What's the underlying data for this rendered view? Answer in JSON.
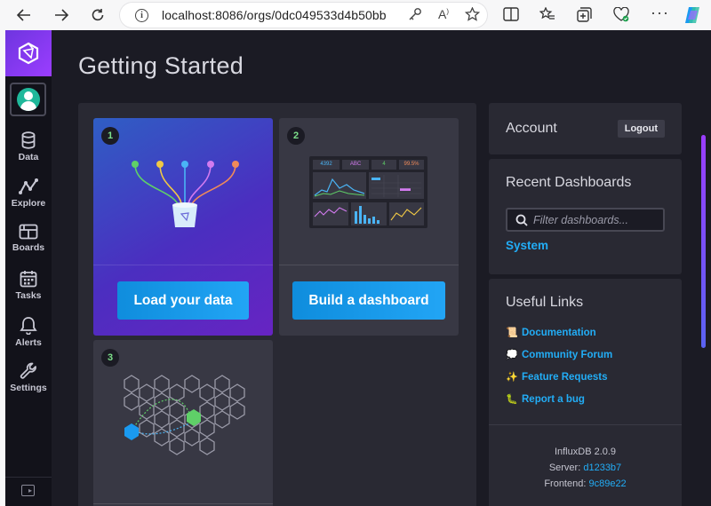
{
  "browser": {
    "url": "localhost:8086/orgs/0dc049533d4b50bb"
  },
  "sidebar": {
    "items": [
      {
        "label": "Data",
        "icon": "database-icon"
      },
      {
        "label": "Explore",
        "icon": "graph-icon"
      },
      {
        "label": "Boards",
        "icon": "dashboards-icon"
      },
      {
        "label": "Tasks",
        "icon": "calendar-icon"
      },
      {
        "label": "Alerts",
        "icon": "bell-icon"
      },
      {
        "label": "Settings",
        "icon": "wrench-icon"
      }
    ]
  },
  "main": {
    "title": "Getting Started",
    "cards": [
      {
        "number": "1",
        "button": "Load your data"
      },
      {
        "number": "2",
        "button": "Build a dashboard"
      },
      {
        "number": "3"
      }
    ],
    "mini_dashboard": {
      "stats": [
        "4392",
        "ABC",
        "4",
        "99.5%"
      ]
    }
  },
  "account": {
    "title": "Account",
    "logout_label": "Logout"
  },
  "recent_dashboards": {
    "title": "Recent Dashboards",
    "filter_placeholder": "Filter dashboards...",
    "items": [
      "System"
    ]
  },
  "useful_links": {
    "title": "Useful Links",
    "links": [
      {
        "emoji": "📜",
        "label": "Documentation"
      },
      {
        "emoji": "💭",
        "label": "Community Forum"
      },
      {
        "emoji": "✨",
        "label": "Feature Requests"
      },
      {
        "emoji": "🐛",
        "label": "Report a bug"
      }
    ]
  },
  "version_info": {
    "product": "InfluxDB 2.0.9",
    "server_label": "Server:",
    "server_value": "d1233b7",
    "frontend_label": "Frontend:",
    "frontend_value": "9c89e22"
  },
  "colors": {
    "accent": "#22adf6",
    "brand_purple": "#9b3dff",
    "success_green": "#7ce08a"
  }
}
